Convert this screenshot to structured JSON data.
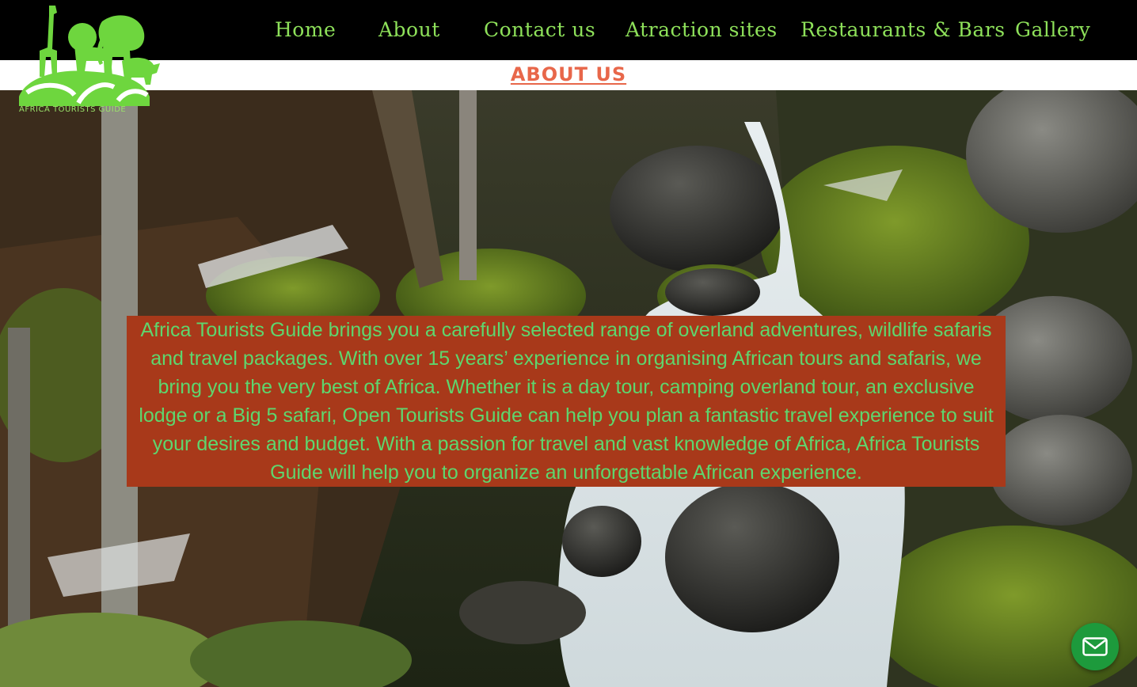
{
  "brand": {
    "logo_text": "AFRICA TOURISTS GUIDE"
  },
  "nav": {
    "items": [
      {
        "label": "Home"
      },
      {
        "label": "About"
      },
      {
        "label": "Contact us"
      },
      {
        "label": "Atraction sites"
      },
      {
        "label": "Restaurants & Bars"
      },
      {
        "label": "Gallery"
      }
    ]
  },
  "page": {
    "title": "ABOUT US"
  },
  "about": {
    "text": "Africa Tourists Guide brings you a carefully selected range of overland adventures, wildlife safaris and travel packages. With over 15 years’ experience in organising African tours and safaris, we bring you the very best of Africa. Whether it is a day tour, camping overland tour, an exclusive lodge or a Big 5 safari, Open Tourists Guide can help you plan a fantastic travel experience to suit your desires and budget. With a passion for travel and vast knowledge of Africa, Africa Tourists Guide will help you to organize an unforgettable African experience."
  },
  "chat": {
    "icon": "mail-icon"
  },
  "colors": {
    "nav_background": "#000000",
    "nav_text": "#8ee15a",
    "title": "#e8674a",
    "panel_background": "#a8391a",
    "panel_text": "#5ed66e",
    "chat_button": "#1d9a3c"
  }
}
